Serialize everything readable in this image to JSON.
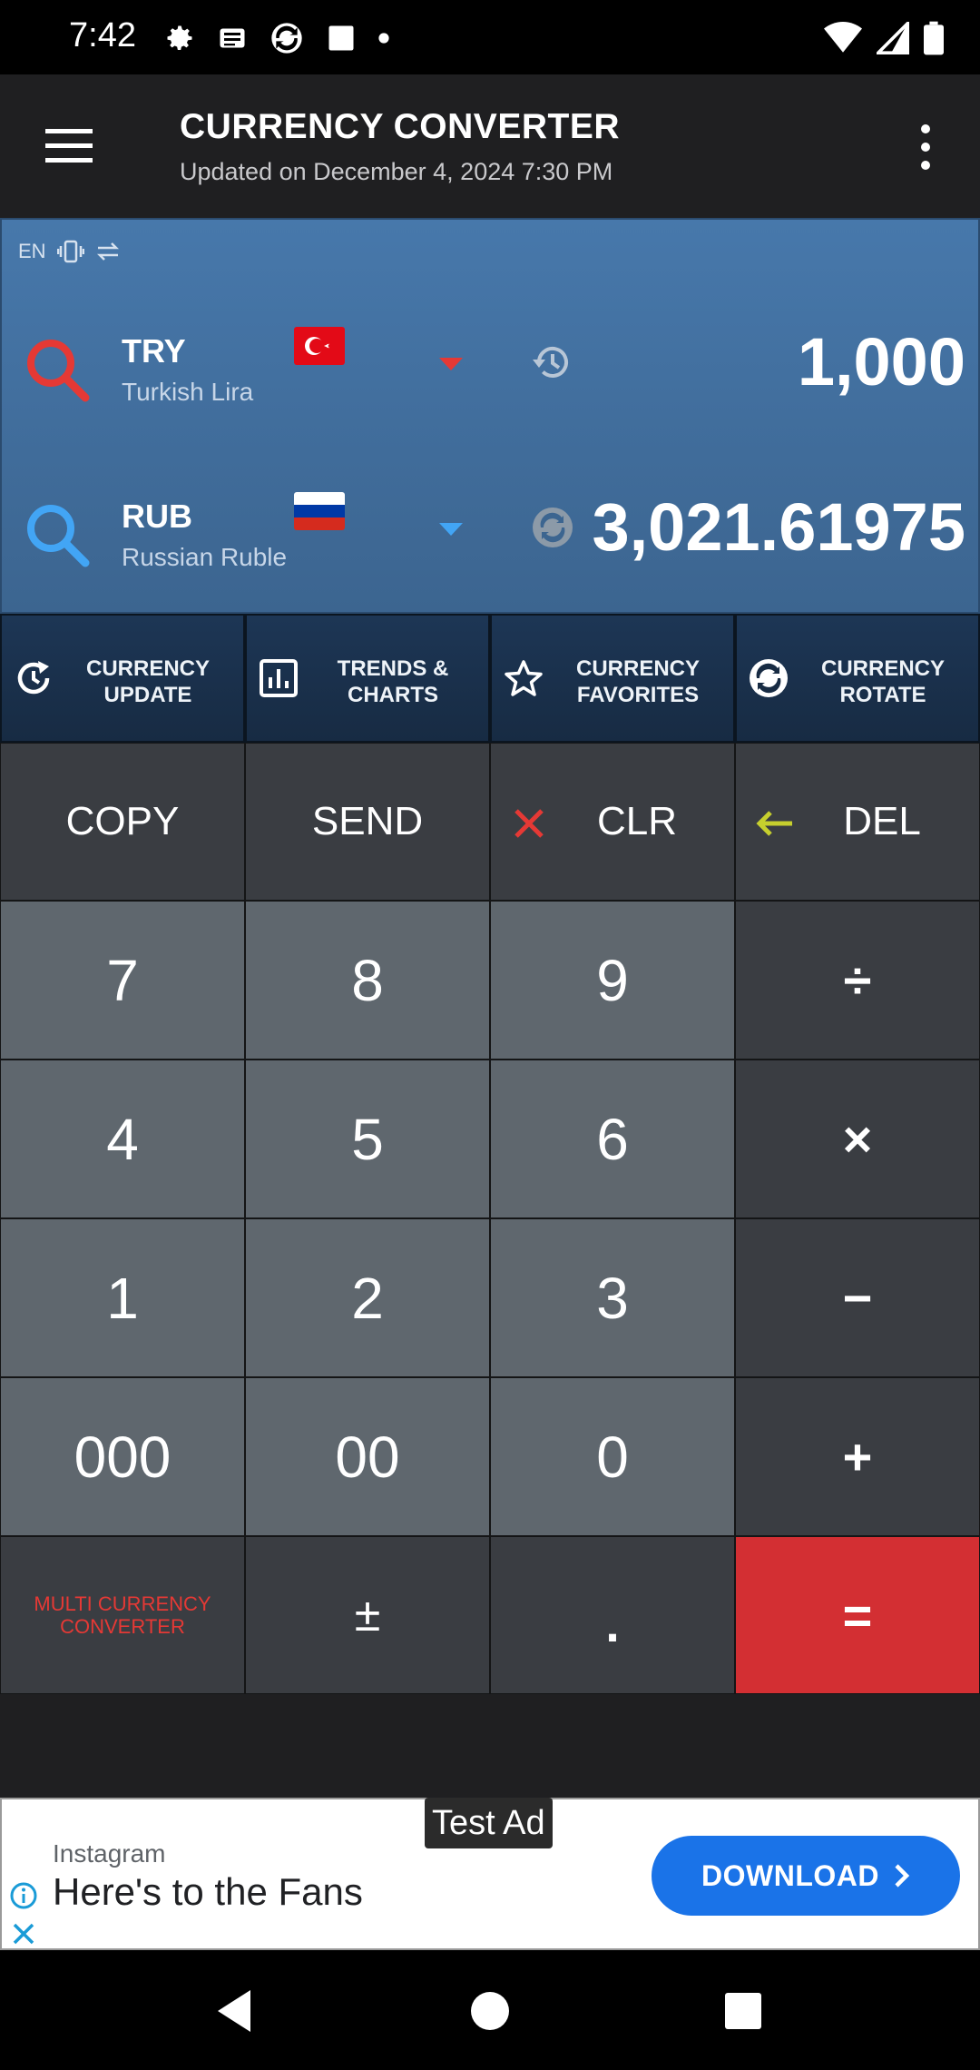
{
  "status_bar": {
    "time": "7:42"
  },
  "app_bar": {
    "title": "CURRENCY CONVERTER",
    "subtitle": "Updated on December 4, 2024 7:30 PM"
  },
  "panel": {
    "language": "EN",
    "from": {
      "code": "TRY",
      "name": "Turkish Lira",
      "amount": "1,000",
      "caret_color": "#e53935",
      "search_color": "#e53935"
    },
    "to": {
      "code": "RUB",
      "name": "Russian Ruble",
      "amount": "3,021.61975",
      "caret_color": "#42a5f5",
      "search_color": "#42a5f5"
    }
  },
  "features": [
    {
      "label_line1": "CURRENCY",
      "label_line2": "UPDATE",
      "icon": "refresh-clock-icon"
    },
    {
      "label_line1": "TRENDS &",
      "label_line2": "CHARTS",
      "icon": "bar-chart-icon"
    },
    {
      "label_line1": "CURRENCY",
      "label_line2": "FAVORITES",
      "icon": "star-icon"
    },
    {
      "label_line1": "CURRENCY",
      "label_line2": "ROTATE",
      "icon": "rotate-icon"
    }
  ],
  "keypad": {
    "copy": "COPY",
    "send": "SEND",
    "clr": "CLR",
    "del": "DEL",
    "k7": "7",
    "k8": "8",
    "k9": "9",
    "divide": "÷",
    "k4": "4",
    "k5": "5",
    "k6": "6",
    "multiply": "×",
    "k1": "1",
    "k2": "2",
    "k3": "3",
    "minus": "−",
    "k000": "000",
    "k00": "00",
    "k0": "0",
    "plus": "+",
    "multi_line1": "MULTI CURRENCY",
    "multi_line2": "CONVERTER",
    "plusminus": "±",
    "dot": ".",
    "equals": "="
  },
  "ad": {
    "badge": "Test Ad",
    "brand": "Instagram",
    "headline": "Here's to the Fans",
    "cta": "DOWNLOAD"
  },
  "colors": {
    "panel_blue": "#4778ab",
    "equals_red": "#d32f33",
    "clr_x": "#e53935",
    "del_arrow": "#c6cf2e",
    "cta_blue": "#1a73e8"
  }
}
